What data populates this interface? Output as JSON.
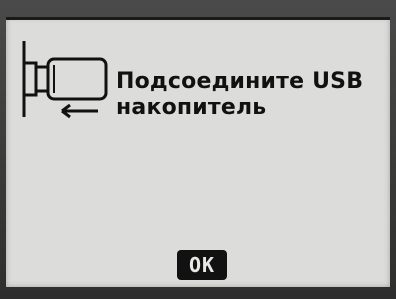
{
  "screen": {
    "message_line1": "Подсоедините USB",
    "message_line2": "накопитель",
    "ok_label": "OK",
    "icon": "usb-connect-icon"
  },
  "colors": {
    "screen_bg": "#dcdcda",
    "ink": "#111111",
    "bezel": "#3a3a3a"
  }
}
